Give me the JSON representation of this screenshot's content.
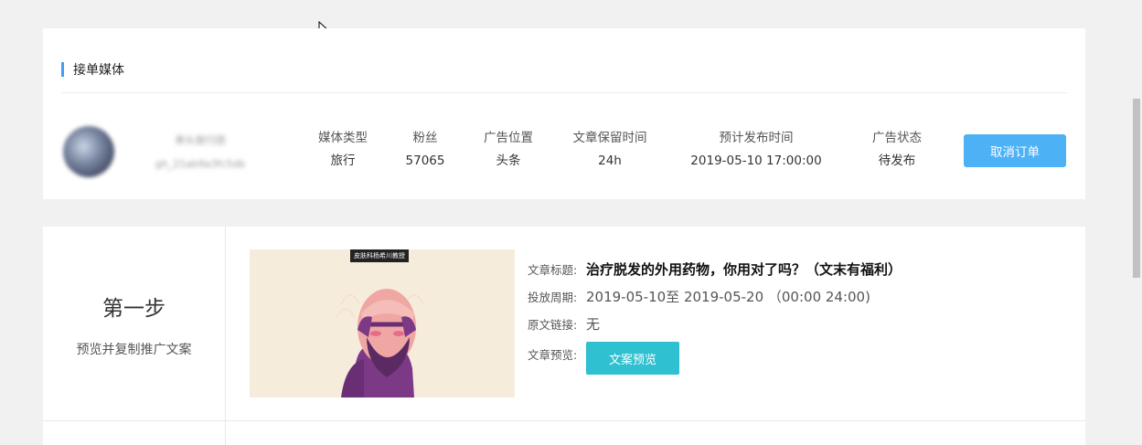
{
  "header": {
    "section_title": "接单媒体"
  },
  "media": {
    "name": "券头旅行团",
    "id": "gh_21ab9a3fc5db"
  },
  "stats": [
    {
      "label": "媒体类型",
      "value": "旅行"
    },
    {
      "label": "粉丝",
      "value": "57065"
    },
    {
      "label": "广告位置",
      "value": "头条"
    },
    {
      "label": "文章保留时间",
      "value": "24h"
    },
    {
      "label": "预计发布时间",
      "value": "2019-05-10 17:00:00"
    },
    {
      "label": "广告状态",
      "value": "待发布"
    }
  ],
  "actions": {
    "cancel_label": "取消订单"
  },
  "step": {
    "title": "第一步",
    "subtitle": "预览并复制推广文案"
  },
  "article": {
    "image_tag": "皮肤科杨希川教授",
    "title_key": "文章标题:",
    "title": "治疗脱发的外用药物，你用对了吗？（文末有福利）",
    "period_key": "投放周期:",
    "period": "2019-05-10至 2019-05-20 （00:00 24:00)",
    "link_key": "原文链接:",
    "link": "无",
    "preview_key": "文章预览:",
    "preview_label": "文案预览"
  },
  "colors": {
    "accent": "#3ea1f5",
    "cancel": "#4db1f6",
    "preview": "#2fc0d1"
  }
}
